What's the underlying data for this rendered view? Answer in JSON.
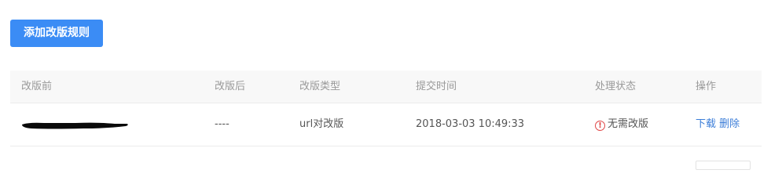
{
  "toolbar": {
    "add_rule_label": "添加改版规则"
  },
  "table": {
    "headers": {
      "before": "改版前",
      "after": "改版后",
      "type": "改版类型",
      "submit_time": "提交时间",
      "status": "处理状态",
      "actions": "操作"
    },
    "rows": [
      {
        "after": "----",
        "type": "url对改版",
        "submit_time": "2018-03-03 10:49:33",
        "status": "无需改版",
        "download_label": "下载",
        "delete_label": "删除"
      }
    ]
  },
  "colors": {
    "primary": "#3b8cf5",
    "link": "#3b7dd8",
    "warning": "#e04848",
    "header_bg": "#f8f8f8"
  },
  "icons": {
    "status_icon": "exclamation-circle-icon"
  }
}
